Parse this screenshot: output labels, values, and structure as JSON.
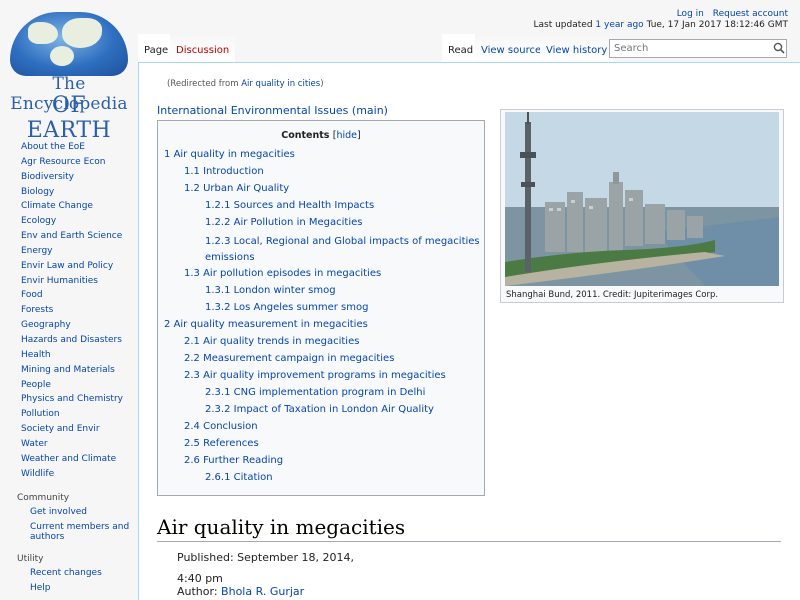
{
  "logo": {
    "line1": "The Encyclopedia",
    "line2": "OF EARTH"
  },
  "header": {
    "login": "Log in",
    "request": "Request account",
    "last_updated_prefix": "Last updated",
    "last_updated_link": "1 year ago",
    "last_updated_date": "Tue, 17 Jan 2017 18:12:46 GMT"
  },
  "tabs": {
    "page": "Page",
    "discussion": "Discussion",
    "read": "Read",
    "view_source": "View source",
    "view_history": "View history"
  },
  "search": {
    "placeholder": "Search"
  },
  "sidebar": {
    "items": [
      "About the EoE",
      "Agr Resource Econ",
      "Biodiversity",
      "Biology",
      "Climate Change",
      "Ecology",
      "Env and Earth Science",
      "Energy",
      "Envir Law and Policy",
      "Envir Humanities",
      "Food",
      "Forests",
      "Geography",
      "Hazards and Disasters",
      "Health",
      "Mining and Materials",
      "People",
      "Physics and Chemistry",
      "Pollution",
      "Society and Envir",
      "Water",
      "Weather and Climate",
      "Wildlife"
    ],
    "community_title": "Community",
    "community": [
      "Get involved",
      "Current members and authors"
    ],
    "utility_title": "Utility",
    "utility": [
      "Recent changes",
      "Help"
    ]
  },
  "content": {
    "redirect_prefix": "(Redirected from",
    "redirect_link": "Air quality in cities",
    "redirect_suffix": ")",
    "category_link": "International Environmental Issues (main)",
    "toc_title": "Contents",
    "toc_hide": "hide",
    "toc": [
      {
        "num": "1",
        "text": "Air quality in megacities",
        "level": 1
      },
      {
        "num": "1.1",
        "text": "Introduction",
        "level": 2
      },
      {
        "num": "1.2",
        "text": "Urban Air Quality",
        "level": 2
      },
      {
        "num": "1.2.1",
        "text": "Sources and Health Impacts",
        "level": 3
      },
      {
        "num": "1.2.2",
        "text": "Air Pollution in Megacities",
        "level": 3
      },
      {
        "num": "1.2.3",
        "text": "Local, Regional and Global impacts of megacities",
        "text2": "emissions",
        "level": 3
      },
      {
        "num": "1.3",
        "text": "Air pollution episodes in megacities",
        "level": 2
      },
      {
        "num": "1.3.1",
        "text": "London winter smog",
        "level": 3
      },
      {
        "num": "1.3.2",
        "text": "Los Angeles summer smog",
        "level": 3
      },
      {
        "num": "2",
        "text": "Air quality measurement in megacities",
        "level": 1
      },
      {
        "num": "2.1",
        "text": "Air quality trends in megacities",
        "level": 2
      },
      {
        "num": "2.2",
        "text": "Measurement campaign in megacities",
        "level": 2
      },
      {
        "num": "2.3",
        "text": "Air quality improvement programs in megacities",
        "level": 2
      },
      {
        "num": "2.3.1",
        "text": "CNG implementation program in Delhi",
        "level": 3
      },
      {
        "num": "2.3.2",
        "text": "Impact of Taxation in London Air Quality",
        "level": 3
      },
      {
        "num": "2.4",
        "text": "Conclusion",
        "level": 2
      },
      {
        "num": "2.5",
        "text": "References",
        "level": 2
      },
      {
        "num": "2.6",
        "text": "Further Reading",
        "level": 2
      },
      {
        "num": "2.6.1",
        "text": "Citation",
        "level": 3
      }
    ],
    "caption": "Shanghai Bund, 2011. Credit: Jupiterimages Corp.",
    "heading": "Air quality in megacities",
    "published": "Published: September 18, 2014, 4:40 pm",
    "author_label": "Author:",
    "author_name": "Bhola R. Gurjar"
  }
}
